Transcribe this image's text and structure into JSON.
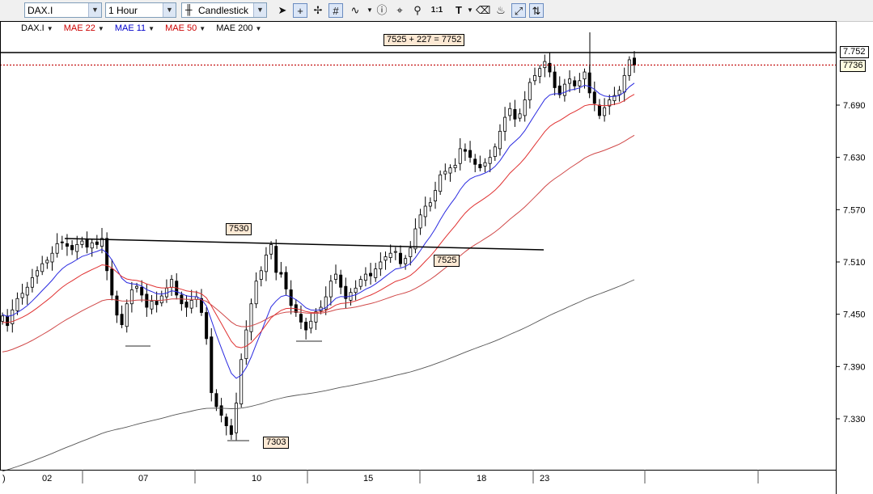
{
  "toolbar": {
    "symbol": "DAX.I",
    "interval": "1 Hour",
    "chart_type": "Candlestick",
    "tools": [
      "pointer-icon",
      "crosshair-icon",
      "data-cursor-icon",
      "grid-icon",
      "wave-icon",
      "dropdown-arrow-icon",
      "info-icon",
      "pin-icon",
      "zoom-icon",
      "scale-1-1-icon",
      "text-tool-icon",
      "eraser-icon",
      "paint-icon",
      "trendline-icon",
      "extend-icon"
    ],
    "scale_label": "1:1",
    "text_tool": "T"
  },
  "indicators": [
    {
      "label": "DAX.I",
      "color": "#000000"
    },
    {
      "label": "MAE 22",
      "color": "#cc0000"
    },
    {
      "label": "MAE 11",
      "color": "#0000cc"
    },
    {
      "label": "MAE 50",
      "color": "#cc0000"
    },
    {
      "label": "MAE 200",
      "color": "#000000"
    }
  ],
  "annotations": {
    "top_note": "7525 + 227 = 7752",
    "resistance": "7530",
    "support_break": "7525",
    "low": "7303"
  },
  "price_labels": {
    "hline": "7.752",
    "last": "7736"
  },
  "chart_data": {
    "type": "candlestick",
    "symbol": "DAX.I",
    "interval": "1 Hour",
    "y_ticks": [
      "7.330",
      "7.390",
      "7.450",
      "7.510",
      "7.570",
      "7.630",
      "7.690"
    ],
    "x_ticks": [
      "02",
      "07",
      "10",
      "15",
      "18",
      "23"
    ],
    "x_first_partial": ")",
    "ylim": [
      7260,
      7775
    ],
    "horizontal_line": 7752,
    "last_price": 7736,
    "close_series": [
      7448,
      7437,
      7455,
      7468,
      7474,
      7481,
      7492,
      7500,
      7508,
      7512,
      7520,
      7531,
      7532,
      7528,
      7524,
      7530,
      7534,
      7527,
      7532,
      7530,
      7537,
      7500,
      7472,
      7449,
      7438,
      7462,
      7478,
      7482,
      7472,
      7458,
      7465,
      7461,
      7471,
      7480,
      7490,
      7472,
      7462,
      7458,
      7466,
      7470,
      7452,
      7422,
      7360,
      7344,
      7334,
      7322,
      7312,
      7348,
      7398,
      7432,
      7462,
      7488,
      7500,
      7518,
      7530,
      7498,
      7496,
      7479,
      7460,
      7452,
      7441,
      7432,
      7442,
      7453,
      7458,
      7470,
      7488,
      7496,
      7481,
      7468,
      7475,
      7480,
      7490,
      7496,
      7494,
      7502,
      7510,
      7516,
      7520,
      7522,
      7508,
      7514,
      7526,
      7548,
      7564,
      7574,
      7578,
      7592,
      7610,
      7614,
      7618,
      7621,
      7640,
      7637,
      7630,
      7622,
      7618,
      7624,
      7630,
      7642,
      7660,
      7676,
      7686,
      7674,
      7680,
      7696,
      7716,
      7724,
      7732,
      7740,
      7728,
      7710,
      7702,
      7714,
      7720,
      7712,
      7718,
      7728,
      7704,
      7692,
      7678,
      7687,
      7696,
      7701,
      7707,
      7724,
      7742,
      7736
    ],
    "annotations": [
      {
        "text": "7525 + 227 = 7752"
      },
      {
        "text": "7530"
      },
      {
        "text": "7525"
      },
      {
        "text": "7303"
      }
    ]
  }
}
